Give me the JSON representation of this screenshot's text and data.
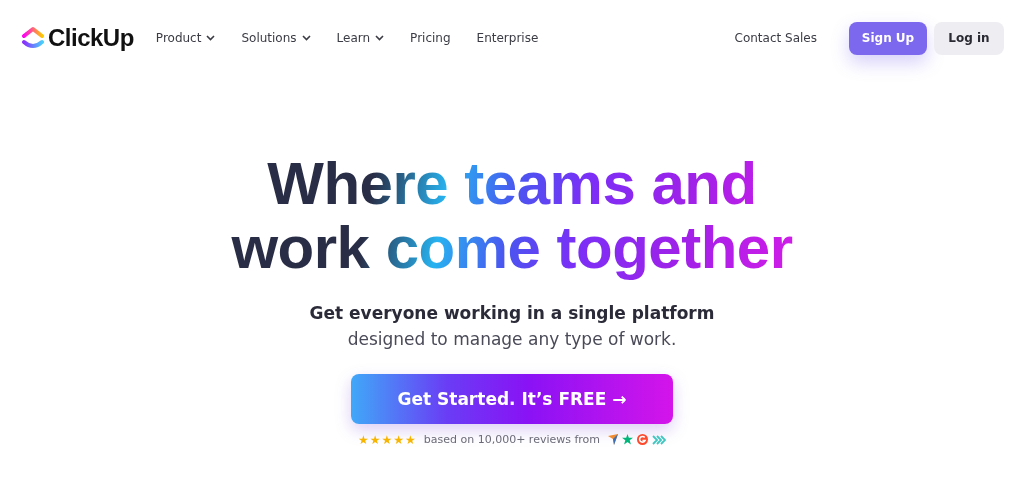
{
  "brand": "ClickUp",
  "nav": [
    {
      "label": "Product",
      "has_menu": true
    },
    {
      "label": "Solutions",
      "has_menu": true
    },
    {
      "label": "Learn",
      "has_menu": true
    },
    {
      "label": "Pricing",
      "has_menu": false
    },
    {
      "label": "Enterprise",
      "has_menu": false
    }
  ],
  "contact": "Contact Sales",
  "signup": "Sign Up",
  "login": "Log in",
  "headline": [
    "Where teams and",
    "work come together"
  ],
  "subtitle": [
    "Get everyone working in a single platform",
    "designed to manage any type of work."
  ],
  "cta": "Get Started. It’s FREE →",
  "rating": {
    "stars": 5,
    "text": "based on 10,000+ reviews from"
  }
}
